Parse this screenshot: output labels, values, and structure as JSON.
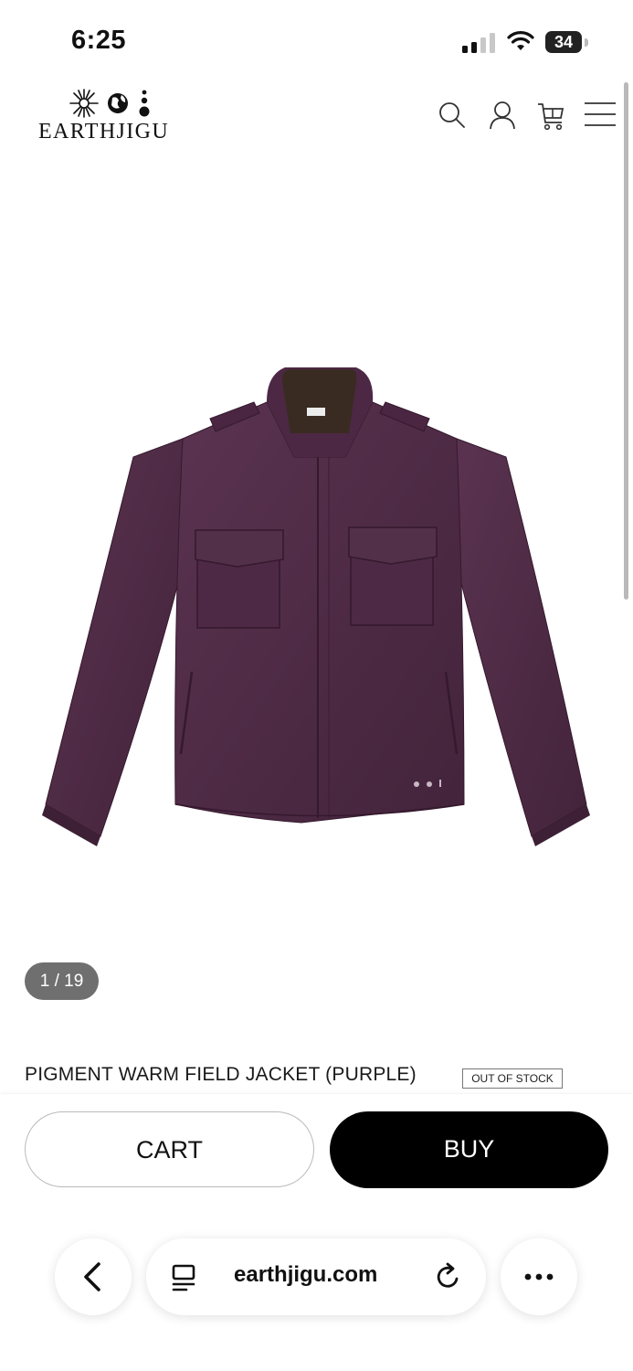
{
  "status_bar": {
    "time": "6:25",
    "battery": "34"
  },
  "header": {
    "brand": "EARTHJIGU"
  },
  "gallery": {
    "counter": "1 / 19"
  },
  "product": {
    "title": "PIGMENT WARM FIELD JACKET (PURPLE)",
    "stock_badge": "OUT OF STOCK",
    "color": "#4f2a44"
  },
  "actions": {
    "cart_label": "CART",
    "buy_label": "BUY"
  },
  "browser": {
    "url": "earthjigu.com"
  },
  "icons": [
    "search-icon",
    "account-icon",
    "cart-icon",
    "menu-icon",
    "back-icon",
    "reader-icon",
    "reload-icon",
    "more-icon"
  ]
}
